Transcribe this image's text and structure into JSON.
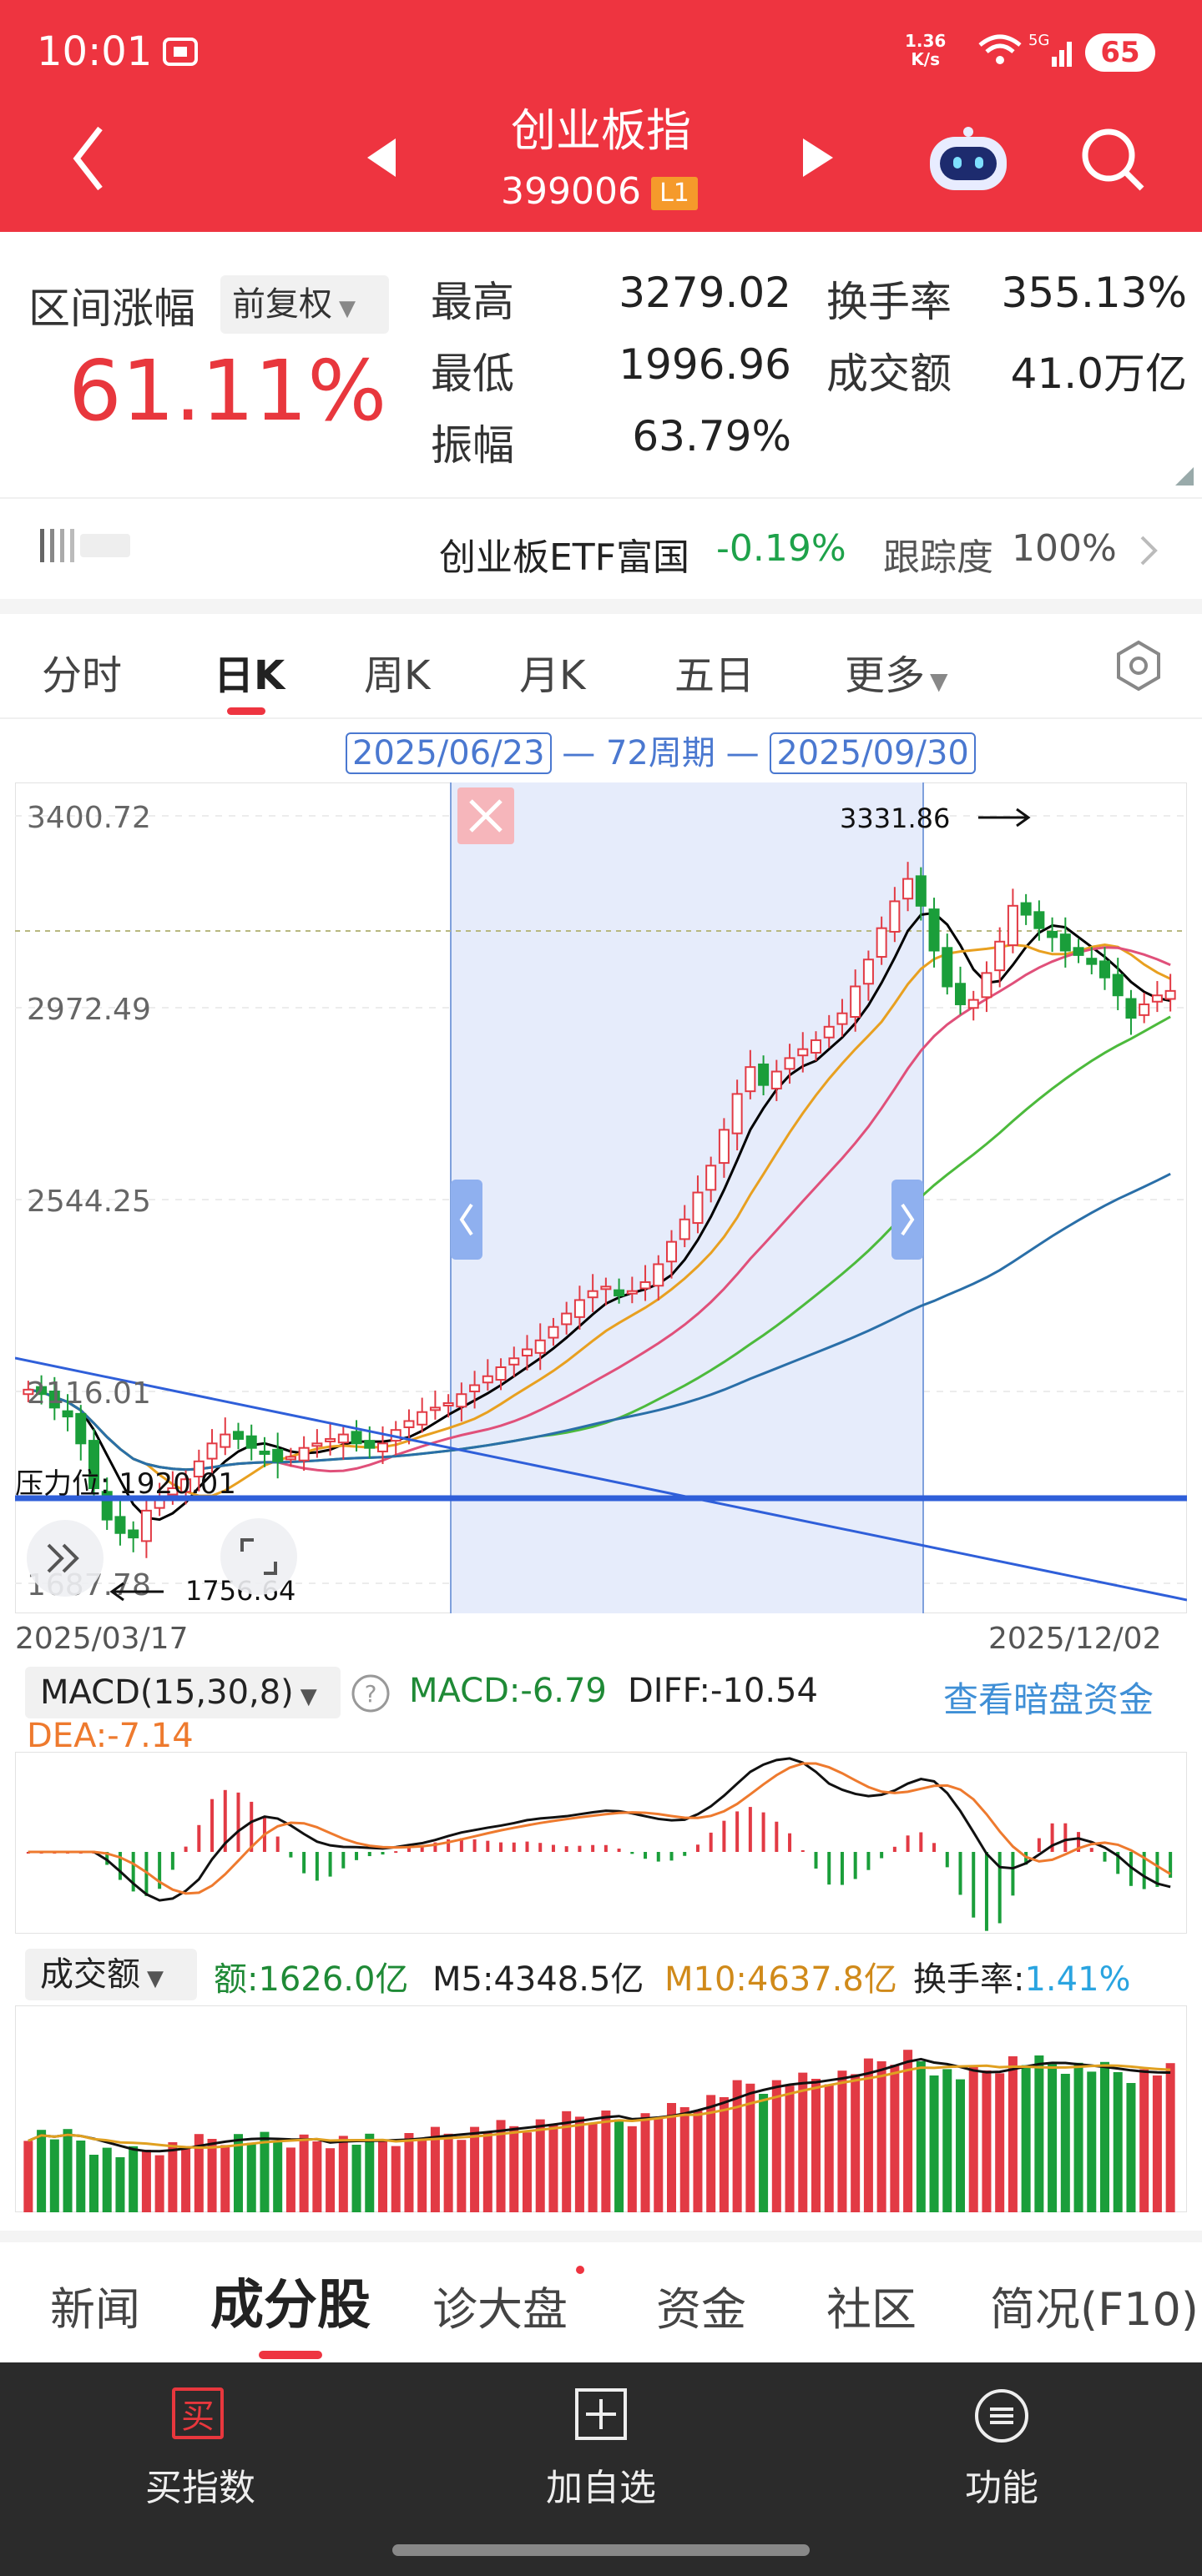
{
  "status": {
    "time": "10:01",
    "net_speed": "1.36\nK/s",
    "battery": "65"
  },
  "header": {
    "title": "创业板指",
    "code": "399006",
    "level": "L1"
  },
  "stats": {
    "range_label": "区间涨幅",
    "adjust": "前复权",
    "range_value": "61.11%",
    "items": [
      {
        "label": "最高",
        "value": "3279.02"
      },
      {
        "label": "换手率",
        "value": "355.13%"
      },
      {
        "label": "最低",
        "value": "1996.96"
      },
      {
        "label": "成交额",
        "value": "41.0万亿"
      },
      {
        "label": "振幅",
        "value": "63.79%"
      }
    ]
  },
  "etf": {
    "name": "创业板ETF富国",
    "change": "-0.19%",
    "track_label": "跟踪度",
    "track_value": "100%"
  },
  "tabs": [
    "分时",
    "日K",
    "周K",
    "月K",
    "五日",
    "更多"
  ],
  "period": {
    "start": "2025/06/23",
    "middle": "72周期",
    "end": "2025/09/30"
  },
  "chart_data": {
    "type": "candlestick",
    "y_ticks": [
      "3400.72",
      "2972.49",
      "2544.25",
      "2116.01",
      "1687.78"
    ],
    "price_high_label": "3331.86",
    "price_low_label": "1756.64",
    "pressure_label": "压力位: 1920.01",
    "date_start": "2025/03/17",
    "date_end": "2025/12/02",
    "colors": {
      "up": "#e23a44",
      "down": "#1a9e3a",
      "ma5": "#000000",
      "ma10": "#e8a020",
      "ma20": "#e0507a",
      "ma60": "#4cba3c",
      "ma120": "#2a6fa8"
    },
    "closes": [
      2120,
      2110,
      2080,
      2060,
      2000,
      1900,
      1830,
      1800,
      1790,
      1850,
      1880,
      1900,
      1920,
      1960,
      2000,
      2020,
      2010,
      1990,
      1980,
      1960,
      1970,
      1990,
      2000,
      2010,
      2020,
      2000,
      1990,
      2000,
      2030,
      2050,
      2070,
      2080,
      2090,
      2110,
      2130,
      2150,
      2170,
      2190,
      2210,
      2230,
      2260,
      2290,
      2320,
      2340,
      2350,
      2330,
      2340,
      2360,
      2400,
      2450,
      2500,
      2560,
      2620,
      2700,
      2780,
      2840,
      2800,
      2830,
      2860,
      2880,
      2900,
      2930,
      2960,
      3020,
      3080,
      3150,
      3210,
      3260,
      3200,
      3100,
      3020,
      2980,
      2990,
      3050,
      3120,
      3200,
      3180,
      3150,
      3130,
      3100,
      3090,
      3070,
      3040,
      3000,
      2950,
      2980,
      3000,
      3010
    ]
  },
  "macd": {
    "label": "MACD(15,30,8)",
    "macd": "MACD:-6.79",
    "diff": "DIFF:-10.54",
    "dea": "DEA:-7.14",
    "link": "查看暗盘资金"
  },
  "volume": {
    "label": "成交额",
    "amount": "额:1626.0亿",
    "m5": "M5:4348.5亿",
    "m10": "M10:4637.8亿",
    "turnover_label": "换手率:",
    "turnover": "1.41%"
  },
  "bottom_tabs": [
    "新闻",
    "成分股",
    "诊大盘",
    "资金",
    "社区",
    "简况(F10)"
  ],
  "nav": [
    {
      "label": "买指数",
      "icon": "买"
    },
    {
      "label": "加自选"
    },
    {
      "label": "功能"
    }
  ]
}
